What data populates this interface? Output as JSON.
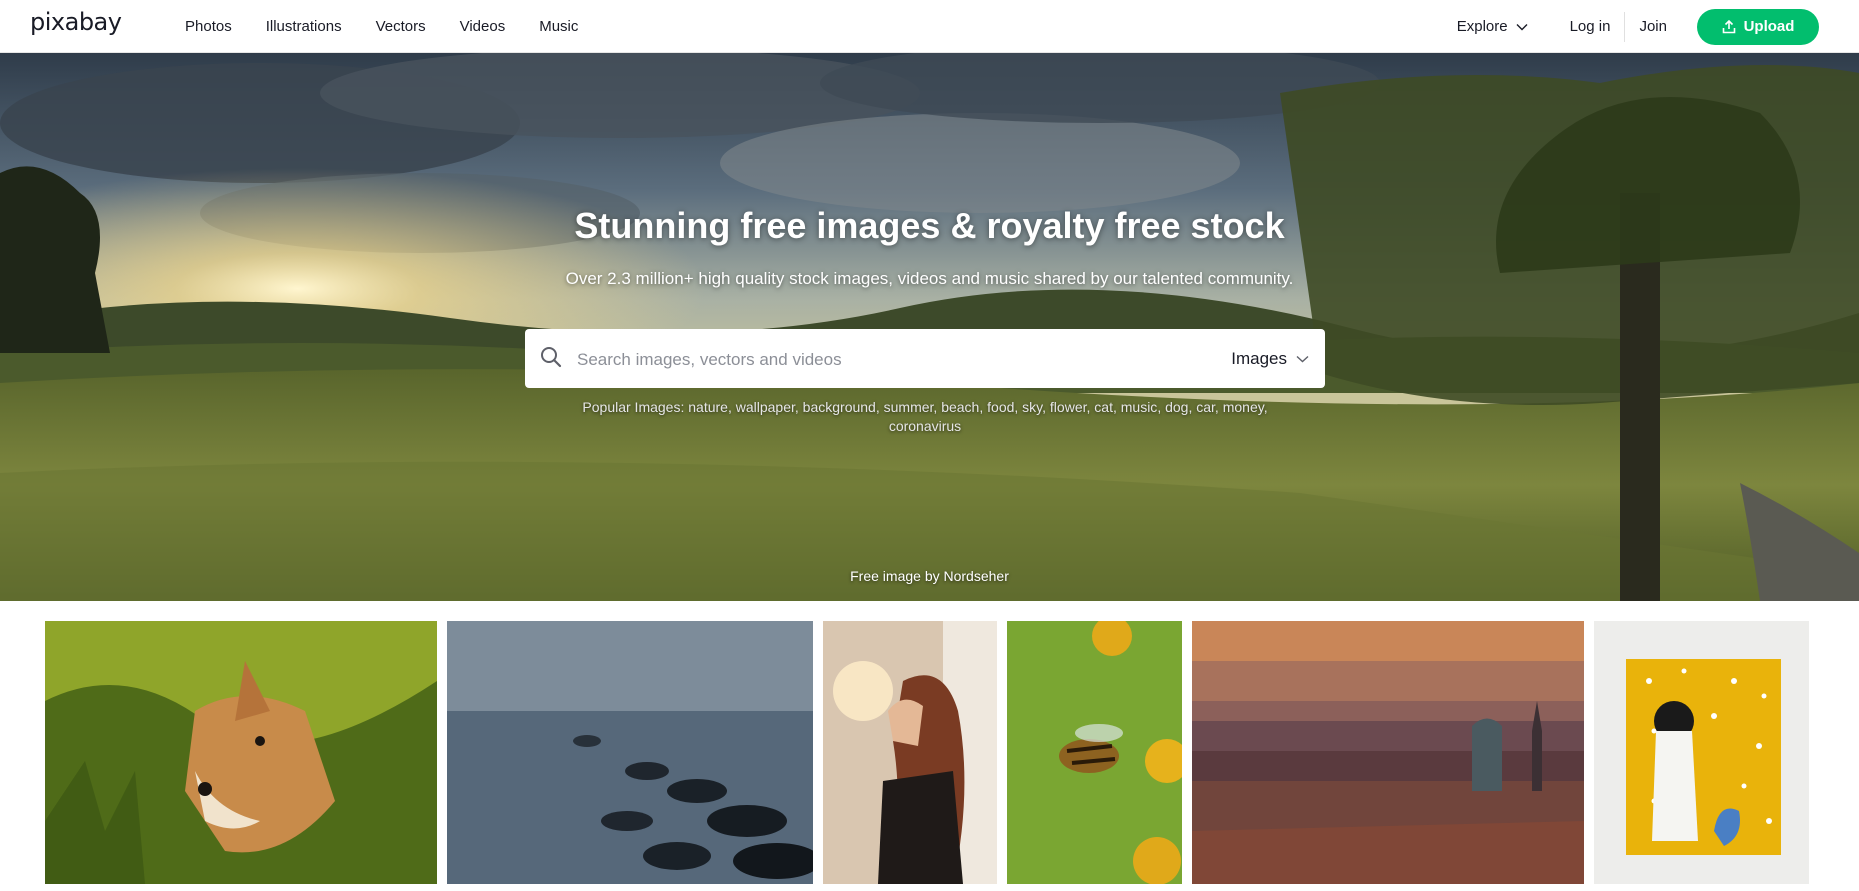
{
  "header": {
    "logo": "pixabay",
    "nav": [
      "Photos",
      "Illustrations",
      "Vectors",
      "Videos",
      "Music"
    ],
    "explore_label": "Explore",
    "login_label": "Log in",
    "join_label": "Join",
    "upload_label": "Upload"
  },
  "hero": {
    "title": "Stunning free images & royalty free stock",
    "subtitle": "Over 2.3 million+ high quality stock images, videos and music shared by our talented community.",
    "search": {
      "placeholder": "Search images, vectors and videos",
      "type_selected": "Images"
    },
    "popular": {
      "label": "Popular Images:",
      "tags": [
        "nature",
        "wallpaper",
        "background",
        "summer",
        "beach",
        "food",
        "sky",
        "flower",
        "cat",
        "music",
        "dog",
        "car",
        "money",
        "coronavirus"
      ]
    },
    "credit_prefix": "Free image by",
    "credit_author": "Nordseher"
  },
  "colors": {
    "brand_green": "#02be6e",
    "text_dark": "#191b26"
  },
  "icons": {
    "search": "search-icon",
    "chevron": "chevron-down-icon",
    "upload": "upload-icon"
  }
}
